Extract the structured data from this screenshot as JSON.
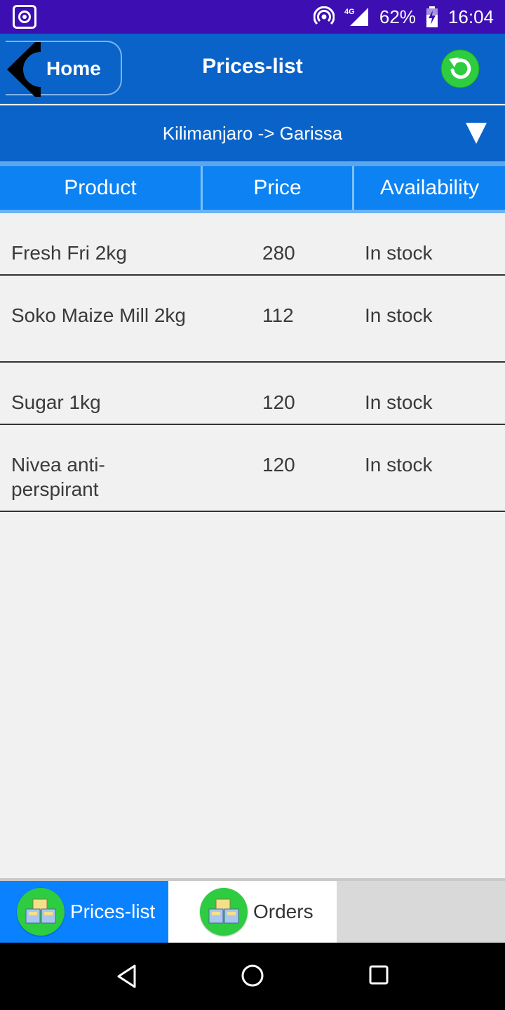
{
  "status_bar": {
    "battery": "62%",
    "time": "16:04",
    "network": "4G"
  },
  "header": {
    "back_label": "Home",
    "title": "Prices-list"
  },
  "route": {
    "selected": "Kilimanjaro -> Garissa"
  },
  "table": {
    "columns": [
      "Product",
      "Price",
      "Availability"
    ],
    "rows": [
      {
        "product": "Fresh Fri 2kg",
        "price": "280",
        "availability": "In stock"
      },
      {
        "product": "Soko Maize Mill 2kg",
        "price": "112",
        "availability": "In stock"
      },
      {
        "product": "Sugar 1kg",
        "price": "120",
        "availability": "In stock"
      },
      {
        "product": "Nivea anti-perspirant",
        "price": "120",
        "availability": "In stock"
      }
    ]
  },
  "tabs": [
    {
      "label": "Prices-list",
      "icon": "boxes-icon",
      "active": true
    },
    {
      "label": "Orders",
      "icon": "boxes-icon",
      "active": false
    }
  ],
  "colors": {
    "status_bar": "#3d0fb3",
    "header": "#0a63c9",
    "table_header": "#0d82f2",
    "active_tab": "#0a82ff",
    "refresh": "#2ecc40"
  }
}
